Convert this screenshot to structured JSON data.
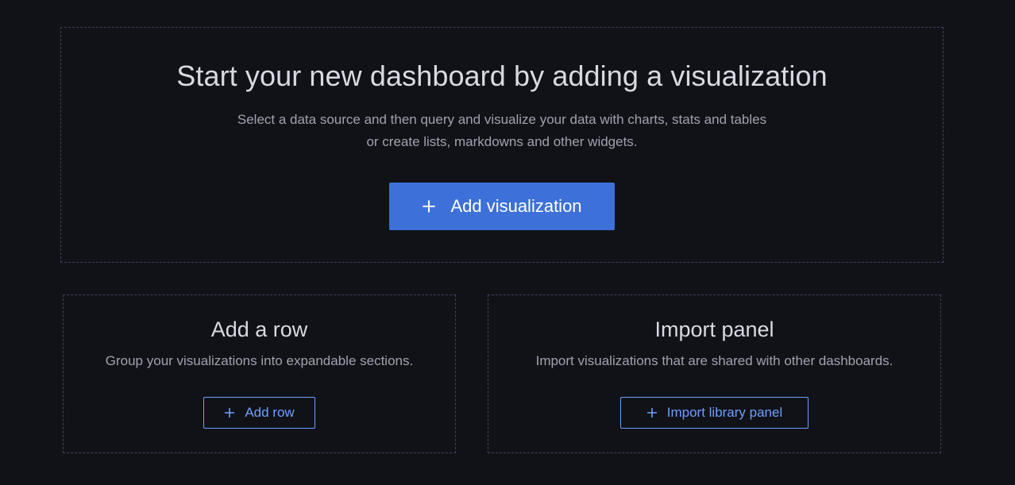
{
  "hero": {
    "title": "Start your new dashboard by adding a visualization",
    "description_line1": "Select a data source and then query and visualize your data with charts, stats and tables",
    "description_line2": "or create lists, markdowns and other widgets.",
    "button_label": "Add visualization",
    "button_icon": "plus-icon",
    "button_color": "#3d71d9"
  },
  "add_row": {
    "title": "Add a row",
    "description": "Group your visualizations into expandable sections.",
    "button_label": "Add row",
    "button_icon": "plus-icon"
  },
  "import_panel": {
    "title": "Import panel",
    "description": "Import visualizations that are shared with other dashboards.",
    "button_label": "Import library panel",
    "button_icon": "plus-icon"
  },
  "colors": {
    "background": "#111217",
    "accent": "#6e9fff",
    "dashed_border": "#3b4260"
  }
}
